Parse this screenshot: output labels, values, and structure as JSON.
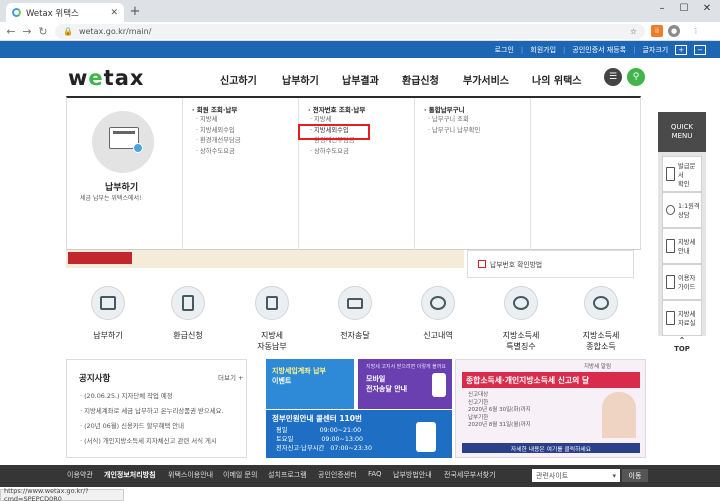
{
  "browser": {
    "tab_title": "Wetax 위택스",
    "url": "wetax.go.kr/main/",
    "status_url": "https://www.wetax.go.kr/?cmd=SPEPCD0R0"
  },
  "topbar": [
    "로그인",
    "회원가입",
    "공인인증서 재등록",
    "글자크기"
  ],
  "logo": {
    "pre": "w",
    "mid": "e",
    "post": "tax"
  },
  "gnb": [
    "신고하기",
    "납부하기",
    "납부결과",
    "환급신청",
    "부가서비스",
    "나의 위택스"
  ],
  "mega": {
    "title": "납부하기",
    "sub": "세금 납부는 위택스에서!",
    "col1": {
      "head": "· 회원 조회·납부",
      "links": [
        "· 지방세",
        "· 지방세외수입",
        "· 환경개선부담금",
        "· 상하수도요금"
      ]
    },
    "col2": {
      "head": "· 전자번호 조회·납부",
      "links": [
        "· 지방세",
        "· 지방세외수입",
        "· 환경개선부담금",
        "· 상하수도요금"
      ]
    },
    "col3": {
      "head": "· 통합납부구니",
      "links": [
        "· 납부구니 조회",
        "· 납부구니 납부확인"
      ]
    }
  },
  "hero_right": "납부번호 확인방법",
  "quick": {
    "head": [
      "QUICK",
      "MENU"
    ],
    "items": [
      [
        "발급문서",
        "확인"
      ],
      [
        "1:1원격",
        "상담"
      ],
      [
        "지방세",
        "안내"
      ],
      [
        "이용자",
        "가이드"
      ],
      [
        "지방세",
        "자료실"
      ]
    ],
    "top": "TOP"
  },
  "services": [
    [
      "납부하기"
    ],
    [
      "환급신청"
    ],
    [
      "지방세",
      "자동납부"
    ],
    [
      "전자송달"
    ],
    [
      "신고내역"
    ],
    [
      "지방소득세",
      "특별징수"
    ],
    [
      "지방소득세",
      "종합소득"
    ]
  ],
  "notice": {
    "title": "공지사항",
    "more": "더보기 +",
    "items": [
      "· (20.06.25.) 지자단체 작업 예정",
      "· 지방세계좌로 세금 납부하고 온누리상품권 받으세요.",
      "· (20년 06월) 신용카드 할부혜택 안내",
      "· (서식) 개인지방소득세 지자체신고 관련 서식 게시"
    ]
  },
  "banners": {
    "b1": [
      "지방세입계좌 납부",
      "이벤트"
    ],
    "b2": [
      "지방세 고지서 받으려면 이렇게 볼까요",
      "모바일",
      "전자송달 안내"
    ],
    "b3": {
      "title": "정부민원안내 콜센터 110번",
      "rows": [
        [
          "평일",
          "09:00~21:00"
        ],
        [
          "토요일",
          "09:00~13:00"
        ],
        [
          "전자신고·납부시간",
          "07:00~23:30"
        ]
      ]
    },
    "b4": {
      "title": "종합소득세·개인지방소득세 신고의 달",
      "badge": "지방세 알림",
      "rows": [
        "신고대상",
        "신고기한",
        "2020년 6월 30일(화)까지",
        "납부기한",
        "2020년 8월 31일(월)까지"
      ],
      "foot": "자세한 내용은 여기를 클릭하세요"
    }
  },
  "footer": {
    "links": [
      "이용약관",
      "개인정보처리방침",
      "위택스이용안내",
      "이메일 문의",
      "설치프로그램",
      "공인인증센터",
      "FAQ",
      "납부방법안내",
      "전국세무부서찾기"
    ],
    "select": "관련사이트",
    "go": "이동"
  }
}
